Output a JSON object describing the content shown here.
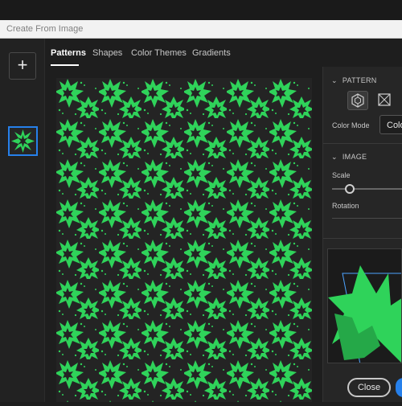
{
  "window": {
    "title": "Create From Image"
  },
  "rail": {
    "add_label": "+"
  },
  "tabs": [
    {
      "label": "Patterns",
      "active": true
    },
    {
      "label": "Shapes",
      "active": false
    },
    {
      "label": "Color Themes",
      "active": false
    },
    {
      "label": "Gradients",
      "active": false
    }
  ],
  "panel": {
    "pattern_heading": "PATTERN",
    "color_mode_label": "Color Mode",
    "color_mode_value": "Colo",
    "image_heading": "IMAGE",
    "scale_label": "Scale",
    "rotation_label": "Rotation"
  },
  "footer": {
    "close_label": "Close"
  },
  "colors": {
    "pattern_green": "#2fd35a",
    "pattern_bg": "#242424",
    "accent": "#2680eb"
  },
  "icons": [
    "plus-icon",
    "hexagon-pattern-icon",
    "grid-pattern-icon",
    "chevron-down-icon"
  ]
}
